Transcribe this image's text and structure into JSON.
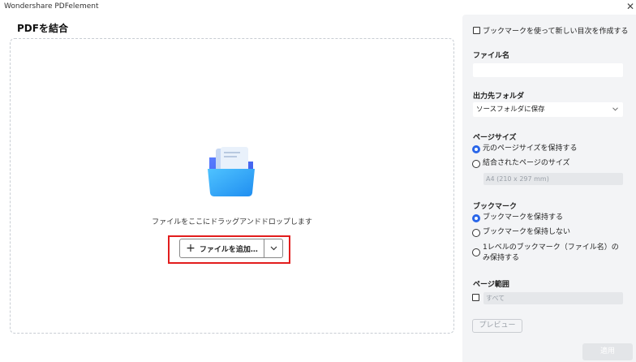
{
  "window": {
    "title": "Wondershare PDFelement",
    "close_glyph": "✕"
  },
  "main": {
    "title": "PDFを結合",
    "drop_text": "ファイルをここにドラッグアンドドロップします",
    "add_files_label": "ファイルを追加…",
    "add_icon": "plus-icon",
    "dropdown_icon": "chevron-down-icon"
  },
  "panel": {
    "toc_checkbox_label": "ブックマークを使って新しい目次を作成する",
    "filename_heading": "ファイル名",
    "filename_value": "",
    "output_heading": "出力先フォルダ",
    "output_selected": "ソースフォルダに保存",
    "page_size_heading": "ページサイズ",
    "page_size_options": [
      "元のページサイズを保持する",
      "結合されたページのサイズ"
    ],
    "page_size_selected_index": 0,
    "page_size_field": "A4 (210 x 297 mm)",
    "bookmark_heading": "ブックマーク",
    "bookmark_options": [
      "ブックマークを保持する",
      "ブックマークを保持しない",
      "1レベルのブックマーク（ファイル名）の",
      "み保持する"
    ],
    "bookmark_selected_index": 0,
    "page_range_heading": "ページ範囲",
    "page_range_placeholder": "すべて",
    "preview_label": "プレビュー",
    "apply_label": "適用"
  },
  "colors": {
    "accent": "#2a66e9",
    "highlight": "#e21d1d",
    "panel_bg": "#f3f4f6"
  }
}
